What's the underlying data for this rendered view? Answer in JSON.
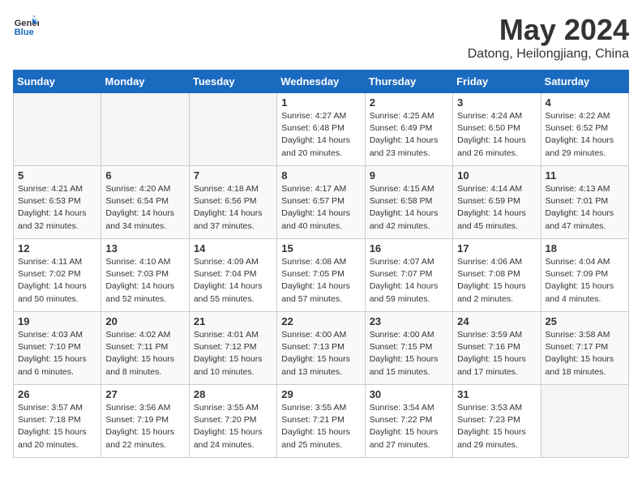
{
  "header": {
    "logo_line1": "General",
    "logo_line2": "Blue",
    "month": "May 2024",
    "location": "Datong, Heilongjiang, China"
  },
  "weekdays": [
    "Sunday",
    "Monday",
    "Tuesday",
    "Wednesday",
    "Thursday",
    "Friday",
    "Saturday"
  ],
  "weeks": [
    [
      {
        "day": "",
        "sunrise": "",
        "sunset": "",
        "daylight": ""
      },
      {
        "day": "",
        "sunrise": "",
        "sunset": "",
        "daylight": ""
      },
      {
        "day": "",
        "sunrise": "",
        "sunset": "",
        "daylight": ""
      },
      {
        "day": "1",
        "sunrise": "Sunrise: 4:27 AM",
        "sunset": "Sunset: 6:48 PM",
        "daylight": "Daylight: 14 hours and 20 minutes."
      },
      {
        "day": "2",
        "sunrise": "Sunrise: 4:25 AM",
        "sunset": "Sunset: 6:49 PM",
        "daylight": "Daylight: 14 hours and 23 minutes."
      },
      {
        "day": "3",
        "sunrise": "Sunrise: 4:24 AM",
        "sunset": "Sunset: 6:50 PM",
        "daylight": "Daylight: 14 hours and 26 minutes."
      },
      {
        "day": "4",
        "sunrise": "Sunrise: 4:22 AM",
        "sunset": "Sunset: 6:52 PM",
        "daylight": "Daylight: 14 hours and 29 minutes."
      }
    ],
    [
      {
        "day": "5",
        "sunrise": "Sunrise: 4:21 AM",
        "sunset": "Sunset: 6:53 PM",
        "daylight": "Daylight: 14 hours and 32 minutes."
      },
      {
        "day": "6",
        "sunrise": "Sunrise: 4:20 AM",
        "sunset": "Sunset: 6:54 PM",
        "daylight": "Daylight: 14 hours and 34 minutes."
      },
      {
        "day": "7",
        "sunrise": "Sunrise: 4:18 AM",
        "sunset": "Sunset: 6:56 PM",
        "daylight": "Daylight: 14 hours and 37 minutes."
      },
      {
        "day": "8",
        "sunrise": "Sunrise: 4:17 AM",
        "sunset": "Sunset: 6:57 PM",
        "daylight": "Daylight: 14 hours and 40 minutes."
      },
      {
        "day": "9",
        "sunrise": "Sunrise: 4:15 AM",
        "sunset": "Sunset: 6:58 PM",
        "daylight": "Daylight: 14 hours and 42 minutes."
      },
      {
        "day": "10",
        "sunrise": "Sunrise: 4:14 AM",
        "sunset": "Sunset: 6:59 PM",
        "daylight": "Daylight: 14 hours and 45 minutes."
      },
      {
        "day": "11",
        "sunrise": "Sunrise: 4:13 AM",
        "sunset": "Sunset: 7:01 PM",
        "daylight": "Daylight: 14 hours and 47 minutes."
      }
    ],
    [
      {
        "day": "12",
        "sunrise": "Sunrise: 4:11 AM",
        "sunset": "Sunset: 7:02 PM",
        "daylight": "Daylight: 14 hours and 50 minutes."
      },
      {
        "day": "13",
        "sunrise": "Sunrise: 4:10 AM",
        "sunset": "Sunset: 7:03 PM",
        "daylight": "Daylight: 14 hours and 52 minutes."
      },
      {
        "day": "14",
        "sunrise": "Sunrise: 4:09 AM",
        "sunset": "Sunset: 7:04 PM",
        "daylight": "Daylight: 14 hours and 55 minutes."
      },
      {
        "day": "15",
        "sunrise": "Sunrise: 4:08 AM",
        "sunset": "Sunset: 7:05 PM",
        "daylight": "Daylight: 14 hours and 57 minutes."
      },
      {
        "day": "16",
        "sunrise": "Sunrise: 4:07 AM",
        "sunset": "Sunset: 7:07 PM",
        "daylight": "Daylight: 14 hours and 59 minutes."
      },
      {
        "day": "17",
        "sunrise": "Sunrise: 4:06 AM",
        "sunset": "Sunset: 7:08 PM",
        "daylight": "Daylight: 15 hours and 2 minutes."
      },
      {
        "day": "18",
        "sunrise": "Sunrise: 4:04 AM",
        "sunset": "Sunset: 7:09 PM",
        "daylight": "Daylight: 15 hours and 4 minutes."
      }
    ],
    [
      {
        "day": "19",
        "sunrise": "Sunrise: 4:03 AM",
        "sunset": "Sunset: 7:10 PM",
        "daylight": "Daylight: 15 hours and 6 minutes."
      },
      {
        "day": "20",
        "sunrise": "Sunrise: 4:02 AM",
        "sunset": "Sunset: 7:11 PM",
        "daylight": "Daylight: 15 hours and 8 minutes."
      },
      {
        "day": "21",
        "sunrise": "Sunrise: 4:01 AM",
        "sunset": "Sunset: 7:12 PM",
        "daylight": "Daylight: 15 hours and 10 minutes."
      },
      {
        "day": "22",
        "sunrise": "Sunrise: 4:00 AM",
        "sunset": "Sunset: 7:13 PM",
        "daylight": "Daylight: 15 hours and 13 minutes."
      },
      {
        "day": "23",
        "sunrise": "Sunrise: 4:00 AM",
        "sunset": "Sunset: 7:15 PM",
        "daylight": "Daylight: 15 hours and 15 minutes."
      },
      {
        "day": "24",
        "sunrise": "Sunrise: 3:59 AM",
        "sunset": "Sunset: 7:16 PM",
        "daylight": "Daylight: 15 hours and 17 minutes."
      },
      {
        "day": "25",
        "sunrise": "Sunrise: 3:58 AM",
        "sunset": "Sunset: 7:17 PM",
        "daylight": "Daylight: 15 hours and 18 minutes."
      }
    ],
    [
      {
        "day": "26",
        "sunrise": "Sunrise: 3:57 AM",
        "sunset": "Sunset: 7:18 PM",
        "daylight": "Daylight: 15 hours and 20 minutes."
      },
      {
        "day": "27",
        "sunrise": "Sunrise: 3:56 AM",
        "sunset": "Sunset: 7:19 PM",
        "daylight": "Daylight: 15 hours and 22 minutes."
      },
      {
        "day": "28",
        "sunrise": "Sunrise: 3:55 AM",
        "sunset": "Sunset: 7:20 PM",
        "daylight": "Daylight: 15 hours and 24 minutes."
      },
      {
        "day": "29",
        "sunrise": "Sunrise: 3:55 AM",
        "sunset": "Sunset: 7:21 PM",
        "daylight": "Daylight: 15 hours and 25 minutes."
      },
      {
        "day": "30",
        "sunrise": "Sunrise: 3:54 AM",
        "sunset": "Sunset: 7:22 PM",
        "daylight": "Daylight: 15 hours and 27 minutes."
      },
      {
        "day": "31",
        "sunrise": "Sunrise: 3:53 AM",
        "sunset": "Sunset: 7:23 PM",
        "daylight": "Daylight: 15 hours and 29 minutes."
      },
      {
        "day": "",
        "sunrise": "",
        "sunset": "",
        "daylight": ""
      }
    ]
  ]
}
